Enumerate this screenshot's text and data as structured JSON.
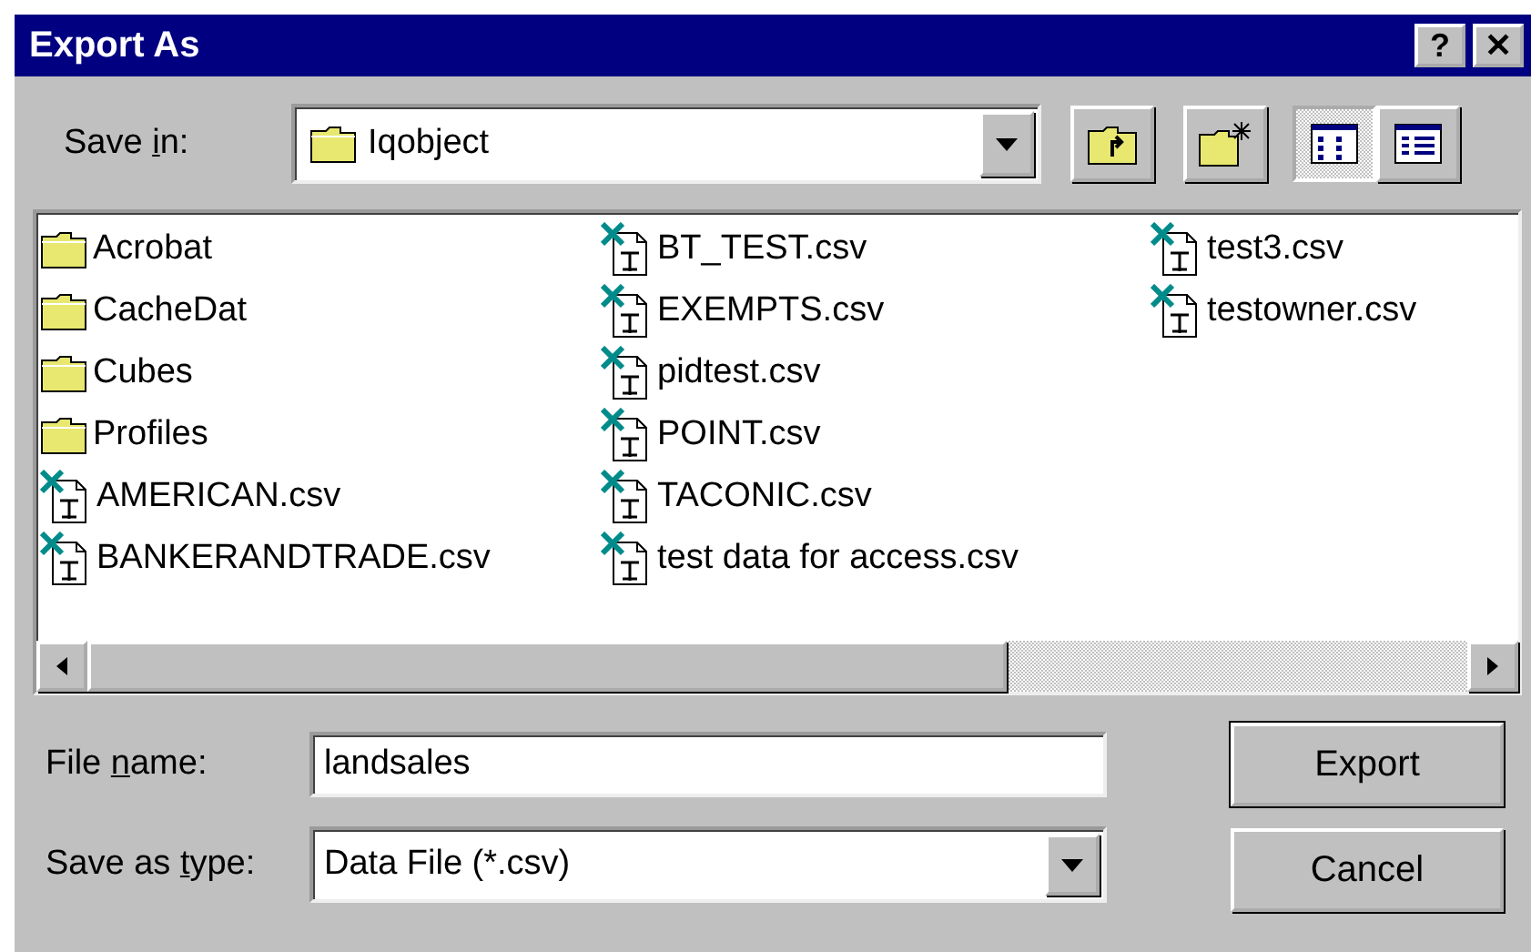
{
  "window": {
    "title": "Export As",
    "title_buttons": [
      {
        "kind": "help",
        "label": "?"
      },
      {
        "kind": "close",
        "label": "✕"
      }
    ]
  },
  "save_in": {
    "label": {
      "before": "Save ",
      "key": "i",
      "after": "n:"
    },
    "value": "Iqobject"
  },
  "toolbar": [
    {
      "kind": "up-folder",
      "selected": false
    },
    {
      "kind": "new-folder",
      "selected": false
    },
    {
      "kind": "list-view",
      "selected": true
    },
    {
      "kind": "details-view",
      "selected": false
    }
  ],
  "files": [
    [
      {
        "kind": "folder",
        "name": "Acrobat"
      },
      {
        "kind": "folder",
        "name": "CacheDat"
      },
      {
        "kind": "folder",
        "name": "Cubes"
      },
      {
        "kind": "folder",
        "name": "Profiles"
      },
      {
        "kind": "csv",
        "name": "AMERICAN.csv"
      },
      {
        "kind": "csv",
        "name": "BANKERANDTRADE.csv"
      }
    ],
    [
      {
        "kind": "csv",
        "name": "BT_TEST.csv"
      },
      {
        "kind": "csv",
        "name": "EXEMPTS.csv"
      },
      {
        "kind": "csv",
        "name": "pidtest.csv"
      },
      {
        "kind": "csv",
        "name": "POINT.csv"
      },
      {
        "kind": "csv",
        "name": "TACONIC.csv"
      },
      {
        "kind": "csv",
        "name": "test data for access.csv"
      }
    ],
    [
      {
        "kind": "csv",
        "name": "test3.csv"
      },
      {
        "kind": "csv",
        "name": "testowner.csv"
      }
    ]
  ],
  "file_name": {
    "label": {
      "before": "File ",
      "key": "n",
      "after": "ame:"
    },
    "value": "landsales"
  },
  "save_as_type": {
    "label": {
      "before": "Save as ",
      "key": "t",
      "after": "ype:"
    },
    "value": "Data File (*.csv)"
  },
  "buttons": [
    {
      "label": "Export",
      "default": true
    },
    {
      "label": "Cancel",
      "default": false
    }
  ]
}
